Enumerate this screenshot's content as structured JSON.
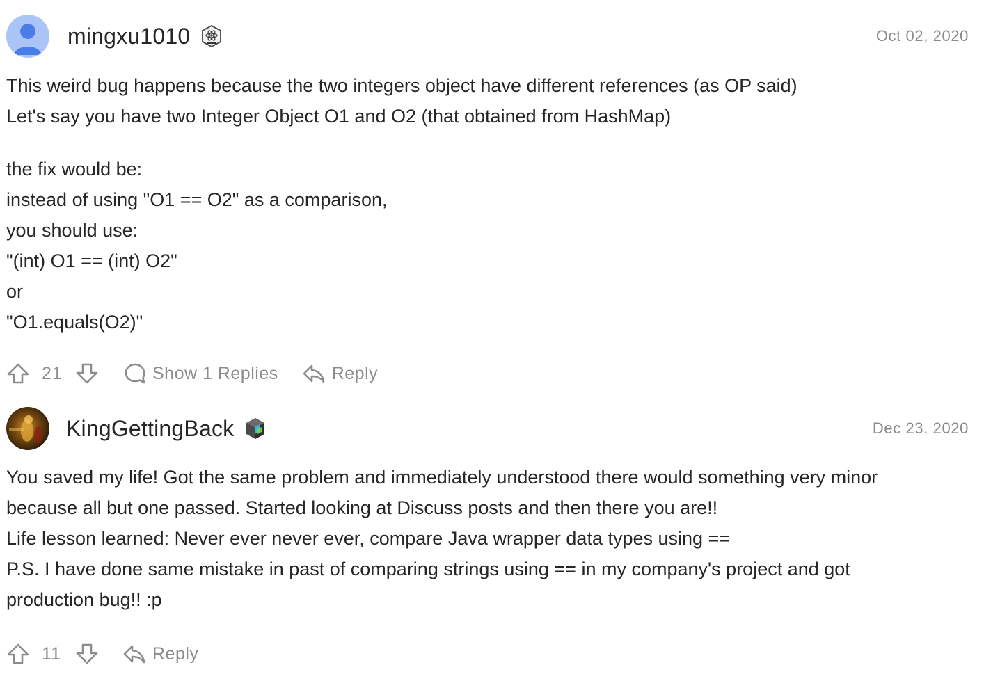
{
  "comments": [
    {
      "username": "mingxu1010",
      "badge_icon": "atom-badge-icon",
      "date": "Oct 02, 2020",
      "paragraph1": [
        "This weird bug happens because the two integers object have different references (as OP said)",
        "Let's say you have two Integer Object O1 and O2 (that obtained from HashMap)"
      ],
      "paragraph2": [
        "the fix would be:",
        "instead of using \"O1 == O2\" as a comparison,",
        "you should use:",
        "\"(int) O1 == (int) O2\"",
        "or",
        "\"O1.equals(O2)\""
      ],
      "votes": "21",
      "show_replies_label": "Show 1 Replies",
      "reply_label": "Reply"
    },
    {
      "username": "KingGettingBack",
      "badge_icon": "cube-badge-icon",
      "date": "Dec 23, 2020",
      "lines": [
        "You saved my life! Got the same problem and immediately understood there would something very minor",
        "because all but one passed. Started looking at Discuss posts and then there you are!!",
        "Life lesson learned: Never ever never ever, compare Java wrapper data types using ==",
        "P.S. I have done same mistake in past of comparing strings using == in my company's project and got",
        "production bug!! :p"
      ],
      "votes": "11",
      "reply_label": "Reply"
    }
  ],
  "colors": {
    "text": "#262626",
    "muted": "#8c8c8c",
    "date": "#8a8a8a",
    "avatar_bg": "#aac4f8",
    "avatar_fg": "#4a7ee6"
  }
}
